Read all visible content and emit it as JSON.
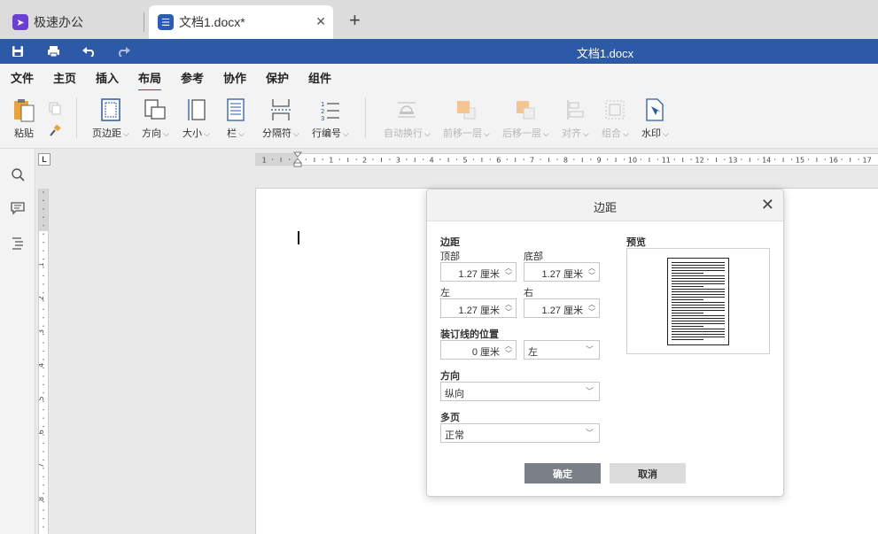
{
  "tabs": [
    {
      "label": "极速办公",
      "icon": "rocket-icon"
    },
    {
      "label": "文档1.docx*",
      "icon": "document-icon"
    }
  ],
  "titlebar": {
    "doc_title": "文档1.docx",
    "quick_access": [
      "save-icon",
      "print-icon",
      "undo-icon",
      "redo-icon"
    ]
  },
  "menu": [
    "文件",
    "主页",
    "插入",
    "布局",
    "参考",
    "协作",
    "保护",
    "组件"
  ],
  "menu_active": "布局",
  "ribbon": {
    "paste": "粘贴",
    "margins": "页边距",
    "orientation": "方向",
    "size": "大小",
    "columns": "栏",
    "breaks": "分隔符",
    "line_numbers": "行编号",
    "wrap": "自动换行",
    "bring_forward": "前移一层",
    "send_backward": "后移一层",
    "align": "对齐",
    "group": "组合",
    "watermark": "水印"
  },
  "ruler": {
    "corner": "L",
    "h_ticks": [
      "1",
      "1",
      "2",
      "3",
      "4",
      "5",
      "6",
      "7",
      "8",
      "9",
      "10",
      "11",
      "12",
      "13",
      "14",
      "15",
      "16",
      "17"
    ],
    "v_ticks": [
      "1",
      "2",
      "3",
      "4",
      "5",
      "6",
      "7",
      "8",
      "9"
    ]
  },
  "dialog": {
    "title": "边距",
    "margins_heading": "边距",
    "top_label": "顶部",
    "top_value": "1.27 厘米",
    "bottom_label": "底部",
    "bottom_value": "1.27 厘米",
    "left_label": "左",
    "left_value": "1.27 厘米",
    "right_label": "右",
    "right_value": "1.27 厘米",
    "gutter_heading": "装订线的位置",
    "gutter_value": "0 厘米",
    "gutter_pos": "左",
    "orientation_heading": "方向",
    "orientation_value": "纵向",
    "multipage_heading": "多页",
    "multipage_value": "正常",
    "preview_heading": "预览",
    "ok": "确定",
    "cancel": "取消"
  },
  "colors": {
    "titlebar": "#2d5aa6",
    "ok_button": "#7b8088",
    "cancel_button": "#dcdcdc"
  }
}
